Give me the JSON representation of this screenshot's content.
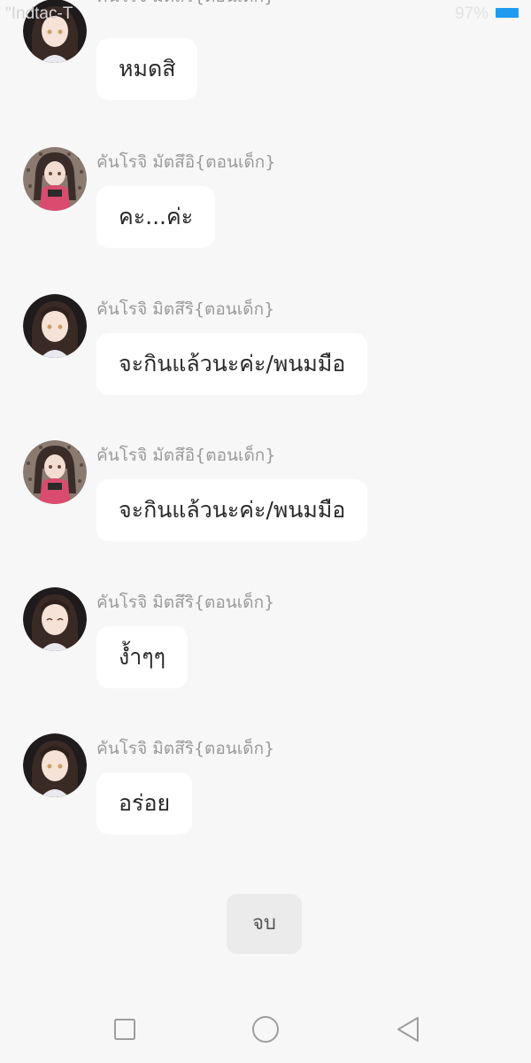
{
  "status_bar": {
    "carrier": "\"Indtac-T",
    "battery_percent": "97%",
    "battery_color": "#1e9bf0"
  },
  "messages": [
    {
      "sender": "คันโรจิ มิตสึริ{ตอนเด็ก}",
      "text": "หมดสิ",
      "avatar": "mitsuri-child-avatar"
    },
    {
      "sender": "คันโรจิ มัตสึอิ{ตอนเด็ก}",
      "text": "คะ...ค่ะ",
      "avatar": "matsui-child-avatar"
    },
    {
      "sender": "คันโรจิ มิตสึริ{ตอนเด็ก}",
      "text": "จะกินแล้วนะค่ะ/พนมมือ",
      "avatar": "mitsuri-child-avatar"
    },
    {
      "sender": "คันโรจิ มัตสึอิ{ตอนเด็ก}",
      "text": "จะกินแล้วนะค่ะ/พนมมือ",
      "avatar": "matsui-child-avatar"
    },
    {
      "sender": "คันโรจิ มิตสึริ{ตอนเด็ก}",
      "text": "ง้ำๆๆ",
      "avatar": "mitsuri-child-avatar"
    },
    {
      "sender": "คันโรจิ มิตสึริ{ตอนเด็ก}",
      "text": "อร่อย",
      "avatar": "mitsuri-child-avatar"
    }
  ],
  "end_button": {
    "label": "จบ"
  },
  "nav_bar": {
    "recent": "square-icon",
    "home": "circle-icon",
    "back": "triangle-back-icon"
  }
}
